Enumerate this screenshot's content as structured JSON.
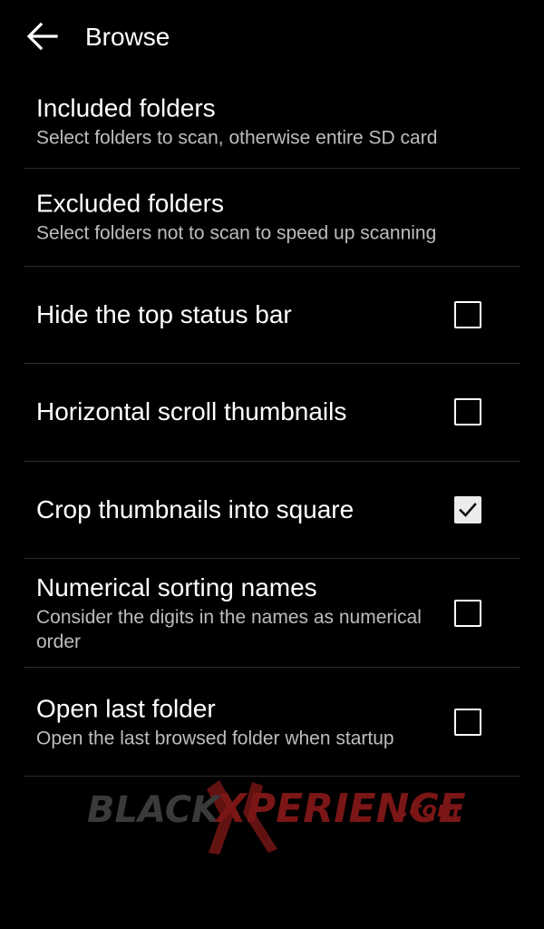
{
  "header": {
    "title": "Browse",
    "back_icon": "arrow-left-icon"
  },
  "settings": [
    {
      "title": "Included folders",
      "summary": "Select folders to scan, otherwise entire SD card",
      "checkbox": null
    },
    {
      "title": "Excluded folders",
      "summary": "Select folders not to scan to speed up scanning",
      "checkbox": null
    },
    {
      "title": "Hide the top status bar",
      "summary": "",
      "checkbox": false
    },
    {
      "title": "Horizontal scroll thumbnails",
      "summary": "",
      "checkbox": false
    },
    {
      "title": "Crop thumbnails into square",
      "summary": "",
      "checkbox": true
    },
    {
      "title": "Numerical sorting names",
      "summary": "Consider the digits in the names as numerical order",
      "checkbox": false
    },
    {
      "title": "Open last folder",
      "summary": "Open the last browsed folder when startup",
      "checkbox": false
    }
  ],
  "watermark": {
    "part1": "BLACK",
    "part2": "XPERIENCE",
    "part3": ".com"
  },
  "colors": {
    "background": "#000000",
    "text_primary": "#ffffff",
    "text_secondary": "#bdbdbd",
    "divider": "#2b2b2b",
    "checkbox_checked_fill": "#ececec",
    "watermark_red": "#8b1a1a"
  }
}
